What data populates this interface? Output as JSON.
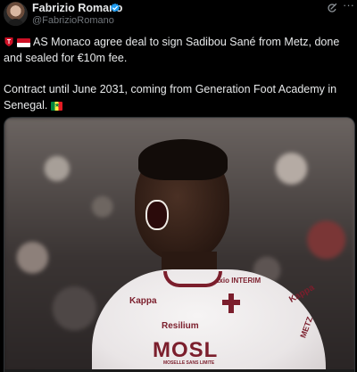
{
  "author": {
    "name": "Fabrizio Romano",
    "handle": "@FabrizioRomano",
    "verified": true,
    "verified_color": "#1d9bf0"
  },
  "header_icons": [
    "grok-icon",
    "more-icon"
  ],
  "tweet": {
    "line1": "AS Monaco agree deal to sign Sadibou Sané from Metz, done and sealed for €10m fee.",
    "line2": "Contract until June 2031, coming from Generation Foot Academy in Senegal."
  },
  "emoji": [
    "club-badge",
    "flag-monaco",
    "flag-senegal"
  ],
  "media": {
    "shirt_sponsors": {
      "resilium": "Resilium",
      "mosl": "MOSL",
      "mosl_sub": "MOSELLE SANS LIMITE",
      "axio": "axio INTERIM",
      "metz": "METZ",
      "kappa": "Kappa"
    },
    "shirt_color": "#7b1e2c"
  },
  "colors": {
    "background": "#000000",
    "text": "#e7e9ea",
    "secondary": "#71767b"
  }
}
